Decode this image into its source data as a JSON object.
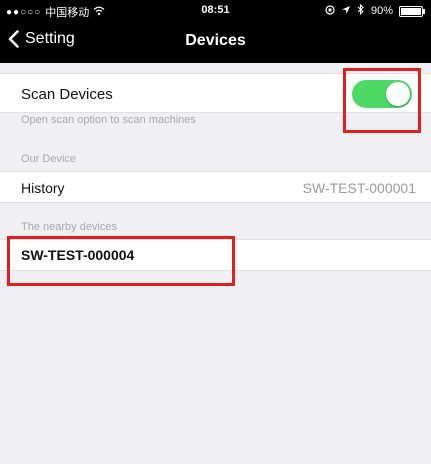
{
  "status_bar": {
    "carrier": "中国移动",
    "wifi_icon": "wifi-icon",
    "time": "08:51",
    "battery": "90%",
    "battery_level": 0.9
  },
  "nav": {
    "back_label": "Setting",
    "title": "Devices"
  },
  "scan": {
    "label": "Scan Devices",
    "enabled": true,
    "hint": "Open scan option to scan machines",
    "toggle_color": "#4cd964"
  },
  "our_device": {
    "header": "Our Device",
    "row_label": "History",
    "row_value": "SW-TEST-000001"
  },
  "nearby": {
    "header": "The nearby devices",
    "items": [
      {
        "label": "SW-TEST-000004"
      }
    ]
  },
  "colors": {
    "annotation": "#e02020",
    "background": "#efeff4"
  }
}
